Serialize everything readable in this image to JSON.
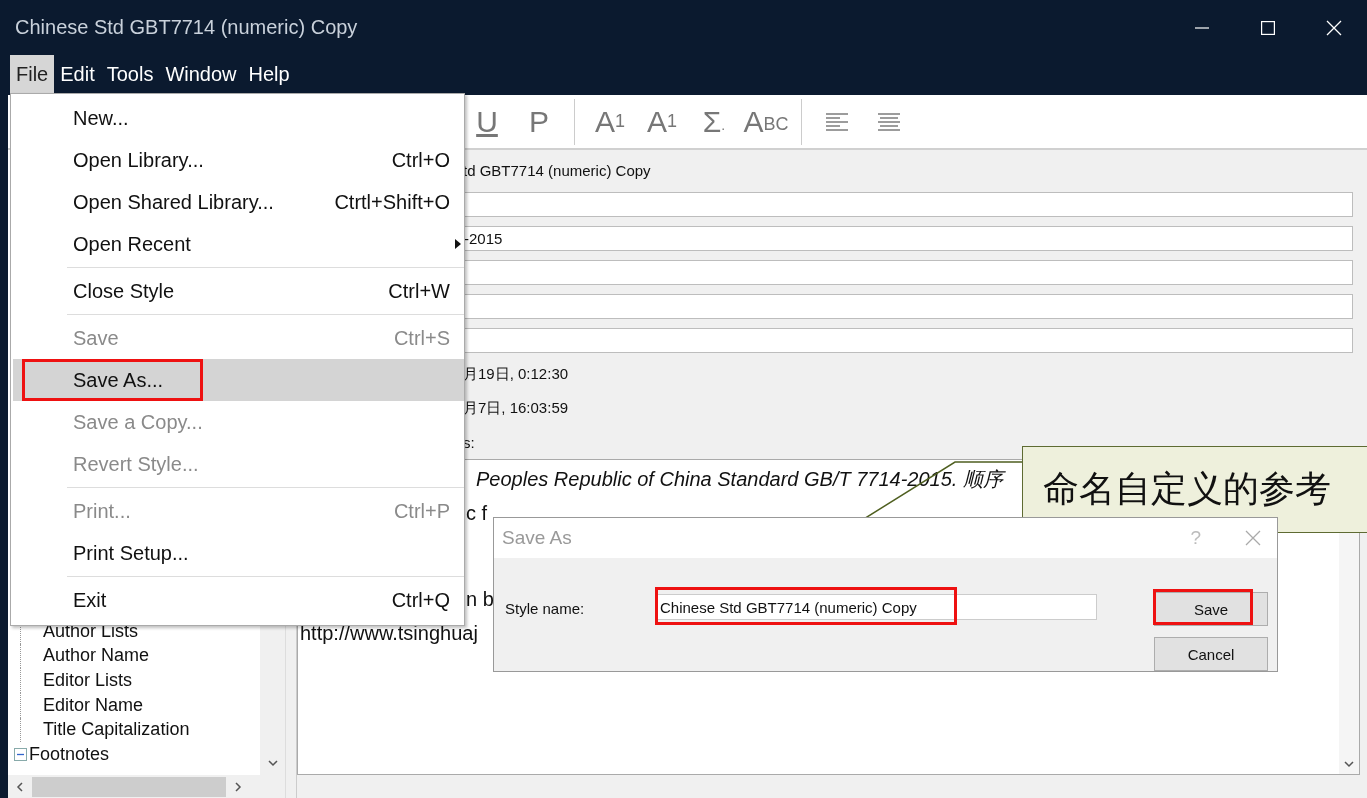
{
  "window": {
    "title": "Chinese Std GBT7714 (numeric) Copy"
  },
  "menu_bar": [
    {
      "label": "File",
      "selected": true
    },
    {
      "label": "Edit",
      "selected": false
    },
    {
      "label": "Tools",
      "selected": false
    },
    {
      "label": "Window",
      "selected": false
    },
    {
      "label": "Help",
      "selected": false
    }
  ],
  "toolbar": [
    {
      "kind": "underline",
      "text": "U"
    },
    {
      "kind": "plain",
      "text": "P"
    },
    {
      "kind": "divider"
    },
    {
      "kind": "superscript",
      "text": "A",
      "small": "1"
    },
    {
      "kind": "subscript",
      "text": "A",
      "small": "1"
    },
    {
      "kind": "symbol",
      "text": "Σ",
      "small": "."
    },
    {
      "kind": "smallcaps",
      "text": "A",
      "small": "BC"
    },
    {
      "kind": "divider"
    },
    {
      "kind": "align-left"
    },
    {
      "kind": "align-center"
    }
  ],
  "file_menu": {
    "groups": [
      [
        {
          "label": "New...",
          "disabled": false,
          "selected": false
        },
        {
          "label": "Open Library...",
          "shortcut": "Ctrl+O",
          "disabled": false,
          "selected": false
        },
        {
          "label": "Open Shared Library...",
          "shortcut": "Ctrtl+Shift+O",
          "disabled": false,
          "selected": false
        },
        {
          "label": "Open Recent",
          "submenu": true,
          "disabled": false,
          "selected": false
        }
      ],
      [
        {
          "label": "Close Style",
          "shortcut": "Ctrl+W",
          "disabled": false,
          "selected": false
        }
      ],
      [
        {
          "label": "Save",
          "shortcut": "Ctrl+S",
          "disabled": true,
          "selected": false
        },
        {
          "label": "Save As...",
          "disabled": false,
          "selected": true
        },
        {
          "label": "Save a Copy...",
          "disabled": true,
          "selected": false
        },
        {
          "label": "Revert Style...",
          "disabled": true,
          "selected": false
        }
      ],
      [
        {
          "label": "Print...",
          "shortcut": "Ctrl+P",
          "disabled": true,
          "selected": false
        },
        {
          "label": "Print Setup...",
          "disabled": false,
          "selected": false
        }
      ],
      [
        {
          "label": "Exit",
          "shortcut": "Ctrl+Q",
          "disabled": false,
          "selected": false
        }
      ]
    ]
  },
  "fields": [
    {
      "kind": "text",
      "value": "td GBT7714 (numeric) Copy"
    },
    {
      "kind": "input"
    },
    {
      "kind": "input",
      "value": "-2015"
    },
    {
      "kind": "input"
    },
    {
      "kind": "input"
    },
    {
      "kind": "input"
    },
    {
      "kind": "text",
      "value": "月19日, 0:12:30"
    },
    {
      "kind": "text",
      "value": "月7日, 16:03:59"
    },
    {
      "kind": "text",
      "value": "s:"
    }
  ],
  "preview": {
    "lines": [
      {
        "text": "Peoples Republic of China Standard GB/T 7714-2015. 顺序",
        "italic": true
      },
      {
        "text": "c f",
        "italic": false
      },
      {
        "text": "n b",
        "italic": false
      },
      {
        "text": "http://www.tsinghuaj",
        "italic": false
      }
    ]
  },
  "tree": {
    "items": [
      {
        "label": "Author Lists",
        "kind": "leaf"
      },
      {
        "label": "Author Name",
        "kind": "leaf"
      },
      {
        "label": "Editor Lists",
        "kind": "leaf"
      },
      {
        "label": "Editor Name",
        "kind": "leaf"
      },
      {
        "label": "Title Capitalization",
        "kind": "leaf"
      },
      {
        "label": "Footnotes",
        "kind": "group",
        "expanded": true
      }
    ]
  },
  "dialog": {
    "title": "Save As",
    "help": "?",
    "label": "Style name:",
    "value": "Chinese Std GBT7714 (numeric) Copy",
    "buttons": [
      {
        "label": "Save"
      },
      {
        "label": "Cancel"
      }
    ]
  },
  "callout": {
    "text": "命名自定义的参考"
  }
}
